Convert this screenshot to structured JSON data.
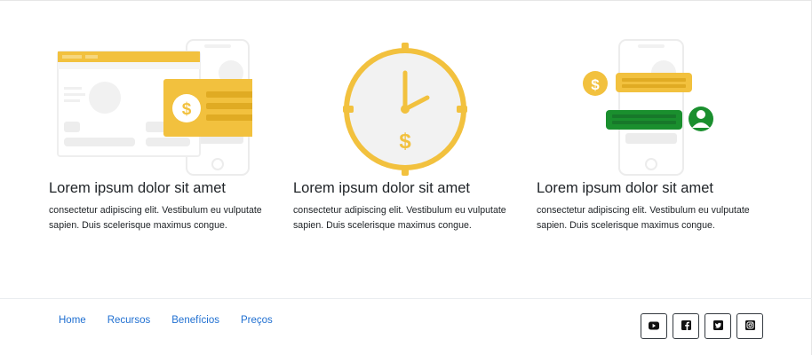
{
  "features": [
    {
      "title": "Lorem ipsum dolor sit amet",
      "text": "consectetur adipiscing elit. Vestibulum eu vulputate sapien. Duis scelerisque maximus congue.",
      "icon": "payment-card-illustration-icon"
    },
    {
      "title": "Lorem ipsum dolor sit amet",
      "text": "consectetur adipiscing elit. Vestibulum eu vulputate sapien. Duis scelerisque maximus congue.",
      "icon": "clock-money-illustration-icon"
    },
    {
      "title": "Lorem ipsum dolor sit amet",
      "text": "consectetur adipiscing elit. Vestibulum eu vulputate sapien. Duis scelerisque maximus congue.",
      "icon": "mobile-chat-payment-illustration-icon"
    }
  ],
  "colors": {
    "accent": "#f2c13e",
    "green": "#1a8f2e",
    "link": "#1f6fd1",
    "muted": "#efefef"
  },
  "footer": {
    "nav": [
      "Home",
      "Recursos",
      "Benefícios",
      "Preços"
    ],
    "social": [
      "youtube-icon",
      "facebook-icon",
      "twitter-icon",
      "instagram-icon"
    ]
  }
}
